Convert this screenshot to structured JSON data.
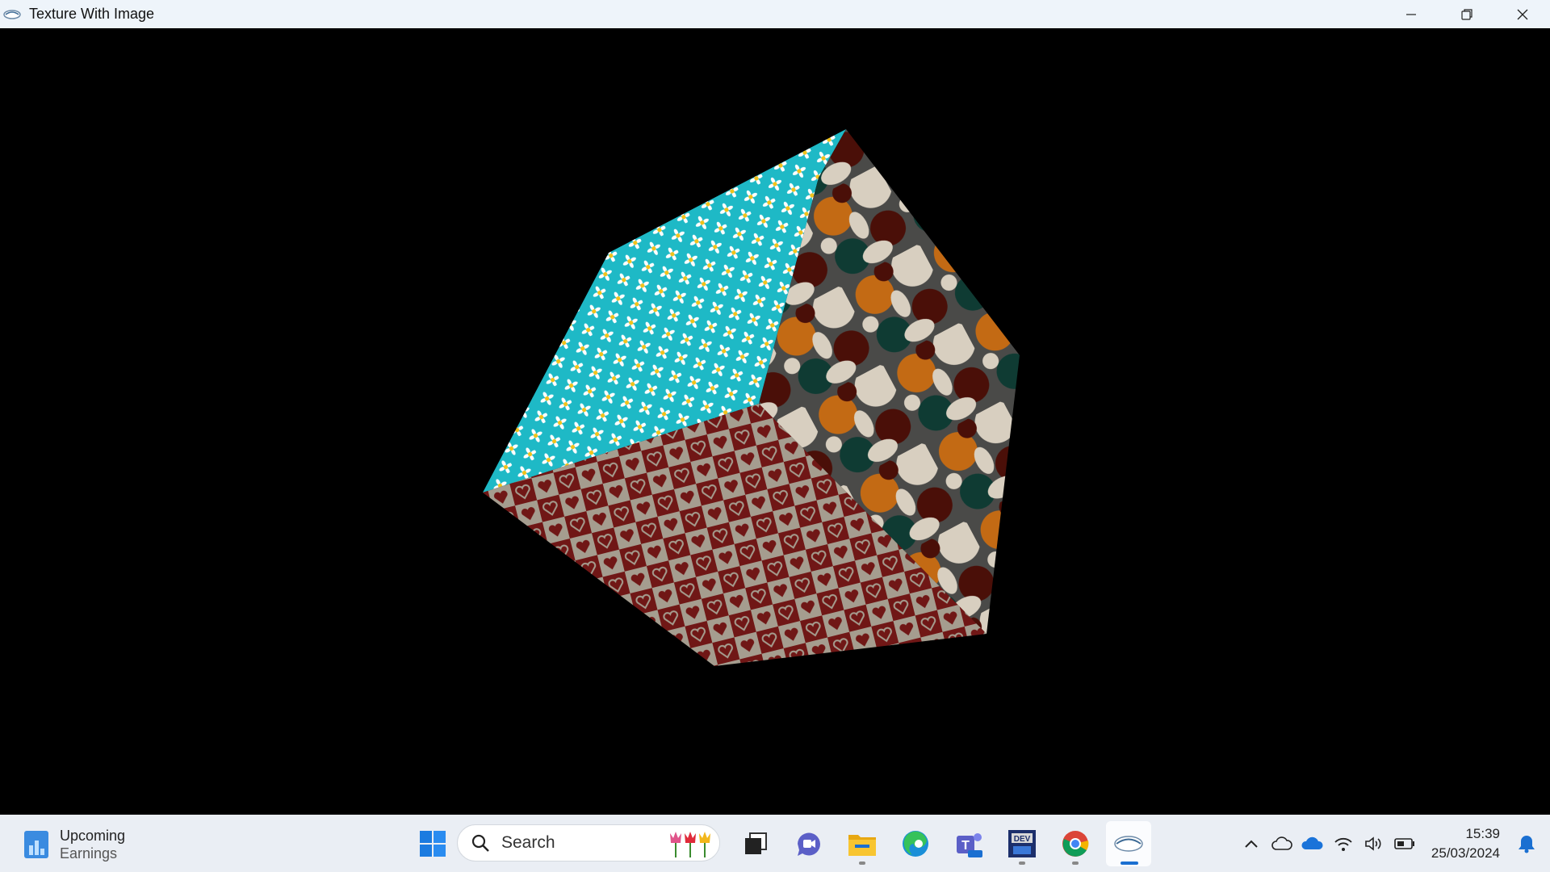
{
  "window": {
    "title": "Texture With Image"
  },
  "taskbar": {
    "widget": {
      "line1": "Upcoming",
      "line2": "Earnings"
    },
    "search": {
      "placeholder": "Search"
    },
    "apps": [
      "start-icon",
      "search",
      "task-view-icon",
      "chat-icon",
      "file-explorer-icon",
      "edge-icon",
      "teams-icon",
      "devcpp-icon",
      "chrome-icon",
      "opengl-app-icon"
    ],
    "clock": {
      "time": "15:39",
      "date": "25/03/2024"
    }
  },
  "scene": {
    "faces": [
      "cyan-daisy-pattern",
      "brown-retro-flower-pattern",
      "red-heart-checker-pattern"
    ],
    "background": "#000000"
  }
}
